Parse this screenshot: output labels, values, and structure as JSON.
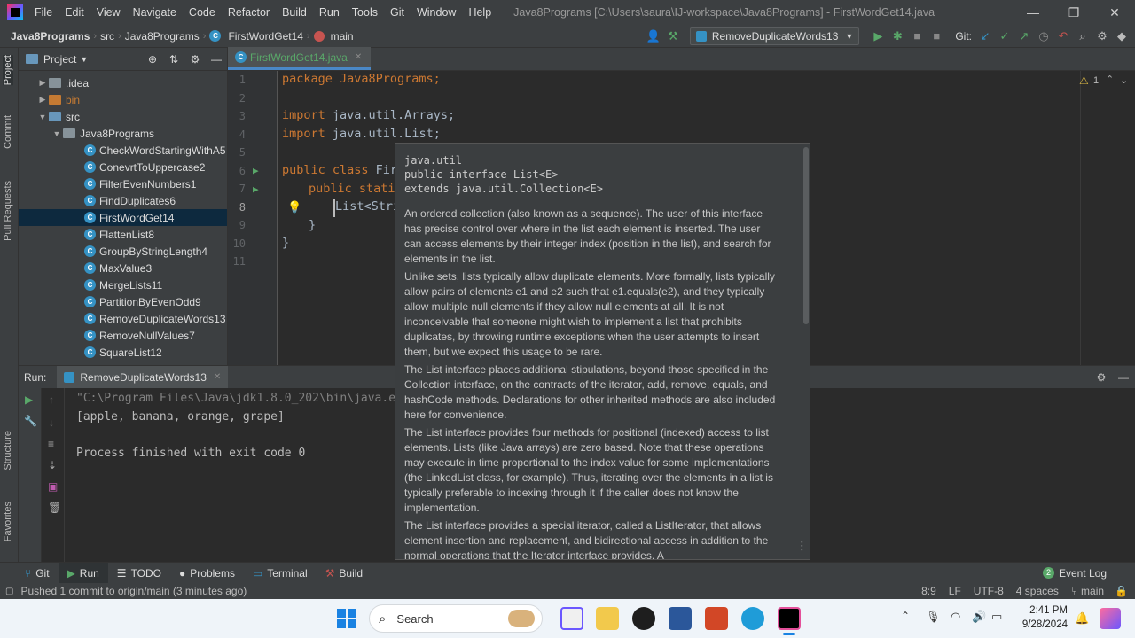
{
  "menubar": {
    "items": [
      "File",
      "Edit",
      "View",
      "Navigate",
      "Code",
      "Refactor",
      "Build",
      "Run",
      "Tools",
      "Git",
      "Window",
      "Help"
    ],
    "title": "Java8Programs [C:\\Users\\saura\\IJ-workspace\\Java8Programs] - FirstWordGet14.java"
  },
  "navbar": {
    "crumbs": [
      "Java8Programs",
      "src",
      "Java8Programs",
      "FirstWordGet14",
      "main"
    ],
    "run_config": "RemoveDuplicateWords13",
    "git_label": "Git:"
  },
  "left_strip": {
    "project": "Project",
    "commit": "Commit",
    "pull_requests": "Pull Requests",
    "structure": "Structure",
    "favorites": "Favorites"
  },
  "project": {
    "title": "Project",
    "rows": [
      {
        "label": ".idea",
        "type": "folder"
      },
      {
        "label": "bin",
        "type": "folder-orange"
      },
      {
        "label": "src",
        "type": "folder-blue"
      },
      {
        "label": "Java8Programs",
        "type": "package"
      },
      {
        "label": "CheckWordStartingWithA5",
        "type": "class"
      },
      {
        "label": "ConevrtToUppercase2",
        "type": "class"
      },
      {
        "label": "FilterEvenNumbers1",
        "type": "class"
      },
      {
        "label": "FindDuplicates6",
        "type": "class"
      },
      {
        "label": "FirstWordGet14",
        "type": "class"
      },
      {
        "label": "FlattenList8",
        "type": "class"
      },
      {
        "label": "GroupByStringLength4",
        "type": "class"
      },
      {
        "label": "MaxValue3",
        "type": "class"
      },
      {
        "label": "MergeLists11",
        "type": "class"
      },
      {
        "label": "PartitionByEvenOdd9",
        "type": "class"
      },
      {
        "label": "RemoveDuplicateWords13",
        "type": "class"
      },
      {
        "label": "RemoveNullValues7",
        "type": "class"
      },
      {
        "label": "SquareList12",
        "type": "class"
      }
    ]
  },
  "editor": {
    "tab": "FirstWordGet14.java",
    "warnings": "1",
    "line_numbers": [
      "1",
      "2",
      "3",
      "4",
      "5",
      "6",
      "7",
      "8",
      "9",
      "10",
      "11"
    ],
    "lines": {
      "l1": "package Java8Programs;",
      "l3_kw": "import",
      "l3": " java.util.Arrays;",
      "l4_kw": "import",
      "l4": " java.util.List;",
      "l6_kw": "public class",
      "l6": " Firs",
      "l7_kw": "public static",
      "l8": "List<Stri",
      "l9": "}",
      "l10": "}"
    }
  },
  "doc_popup": {
    "package": "java.util",
    "signature": "public interface List<E>",
    "extends": "extends java.util.Collection<E>",
    "p1": "An ordered collection (also known as a sequence). The user of this interface has precise control over where in the list each element is inserted. The user can access elements by their integer index (position in the list), and search for elements in the list.",
    "p2": "Unlike sets, lists typically allow duplicate elements. More formally, lists typically allow pairs of elements e1 and e2 such that e1.equals(e2), and they typically allow multiple null elements if they allow null elements at all. It is not inconceivable that someone might wish to implement a list that prohibits duplicates, by throwing runtime exceptions when the user attempts to insert them, but we expect this usage to be rare.",
    "p3": "The List interface places additional stipulations, beyond those specified in the Collection interface, on the contracts of the iterator, add, remove, equals, and hashCode methods. Declarations for other inherited methods are also included here for convenience.",
    "p4": "The List interface provides four methods for positional (indexed) access to list elements. Lists (like Java arrays) are zero based. Note that these operations may execute in time proportional to the index value for some implementations (the LinkedList class, for example). Thus, iterating over the elements in a list is typically preferable to indexing through it if the caller does not know the implementation.",
    "p5": "The List interface provides a special iterator, called a ListIterator, that allows element insertion and replacement, and bidirectional access in addition to the normal operations that the Iterator interface provides. A"
  },
  "run": {
    "label": "Run:",
    "tab": "RemoveDuplicateWords13",
    "cmd": "\"C:\\Program Files\\Java\\jdk1.8.0_202\\bin\\java.exe",
    "output": "[apple, banana, orange, grape]",
    "exit": "Process finished with exit code 0"
  },
  "bottom_tabs": [
    "Git",
    "Run",
    "TODO",
    "Problems",
    "Terminal",
    "Build"
  ],
  "event_log": "Event Log",
  "status": {
    "message": "Pushed 1 commit to origin/main (3 minutes ago)",
    "position": "8:9",
    "line_sep": "LF",
    "encoding": "UTF-8",
    "indent": "4 spaces",
    "branch": "main"
  },
  "taskbar": {
    "search": "Search",
    "time": "2:41 PM",
    "date": "9/28/2024"
  }
}
